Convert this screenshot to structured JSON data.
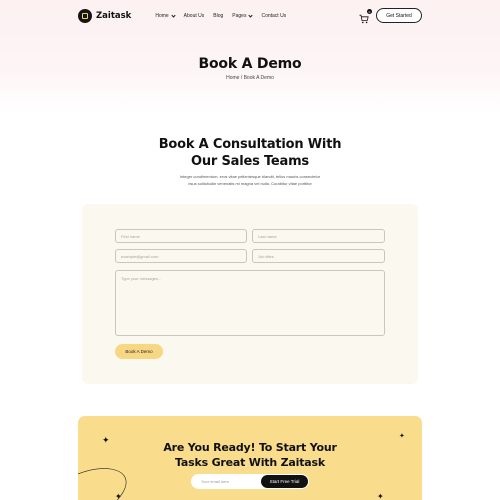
{
  "brand": {
    "name": "Zaitask"
  },
  "nav": {
    "items": [
      {
        "label": "Home",
        "dropdown": true
      },
      {
        "label": "About Us",
        "dropdown": false
      },
      {
        "label": "Blog",
        "dropdown": false
      },
      {
        "label": "Pages",
        "dropdown": true
      },
      {
        "label": "Contact Us",
        "dropdown": false
      }
    ],
    "cart_count": "0",
    "cta_label": "Get Started"
  },
  "hero": {
    "title": "Book A Demo",
    "breadcrumb": "Home / Book A Demo"
  },
  "consultation": {
    "title_line1": "Book A Consultation With",
    "title_line2": "Our Sales Teams",
    "desc_line1": "Integer condimentum, eros vitae pellentesque blandit, tellus mauris consectetur",
    "desc_line2": "risus sollicitudin venenatis mi magna vel nulla. Curabitur vitae porttitor"
  },
  "form": {
    "first_name_placeholder": "First name",
    "last_name_placeholder": "Last name",
    "email_placeholder": "example@gmail.com",
    "job_title_placeholder": "Job titles",
    "message_placeholder": "Type your messages...",
    "submit_label": "Book A Demo"
  },
  "cta": {
    "title_line1": "Are You Ready! To Start Your",
    "title_line2": "Tasks Great With Zaitask",
    "email_placeholder": "Your email here",
    "button_label": "Start Free Trial"
  },
  "colors": {
    "accent_yellow": "#f9dc8c",
    "button_yellow": "#f7d783",
    "form_bg": "#fbf8ef",
    "hero_pink": "#fdf1f2",
    "dark": "#111111"
  },
  "icons": [
    "logo-icon",
    "cart-icon",
    "sparkle-icon",
    "chevron-down-icon"
  ]
}
